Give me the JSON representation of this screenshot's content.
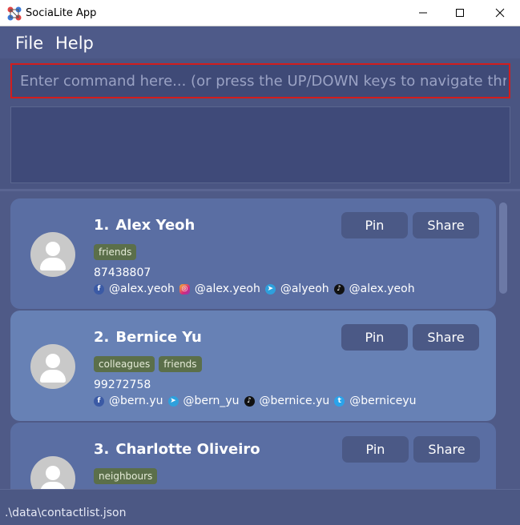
{
  "window": {
    "title": "SociaLite App",
    "controls": {
      "minimize": "—",
      "maximize": "☐",
      "close": "✕"
    }
  },
  "menu": {
    "file": "File",
    "help": "Help"
  },
  "command": {
    "value": "",
    "placeholder": "Enter command here... (or press the UP/DOWN keys to navigate through history)"
  },
  "result": {
    "text": ""
  },
  "contacts": [
    {
      "index": "1.",
      "name": "Alex Yeoh",
      "tags": [
        "friends"
      ],
      "phone": "87438807",
      "socials": [
        {
          "icon": "facebook-icon",
          "handle": "@alex.yeoh"
        },
        {
          "icon": "instagram-icon",
          "handle": "@alex.yeoh"
        },
        {
          "icon": "telegram-icon",
          "handle": "@alyeoh"
        },
        {
          "icon": "tiktok-icon",
          "handle": "@alex.yeoh"
        }
      ],
      "pin_label": "Pin",
      "share_label": "Share"
    },
    {
      "index": "2.",
      "name": "Bernice Yu",
      "tags": [
        "colleagues",
        "friends"
      ],
      "phone": "99272758",
      "socials": [
        {
          "icon": "facebook-icon",
          "handle": "@bern.yu"
        },
        {
          "icon": "telegram-icon",
          "handle": "@bern_yu"
        },
        {
          "icon": "tiktok-icon",
          "handle": "@bernice.yu"
        },
        {
          "icon": "twitter-icon",
          "handle": "@berniceyu"
        }
      ],
      "pin_label": "Pin",
      "share_label": "Share"
    },
    {
      "index": "3.",
      "name": "Charlotte Oliveiro",
      "tags": [
        "neighbours"
      ],
      "phone": "",
      "socials": [],
      "pin_label": "Pin",
      "share_label": "Share"
    }
  ],
  "status": {
    "path": ".\\data\\contactlist.json"
  },
  "colors": {
    "background": "#4f5a87",
    "card": "#5a6ea3",
    "card_alt": "#6781b5",
    "tag": "#5b6f4a",
    "button": "#4b5986",
    "focus_border": "#d21d1d"
  }
}
